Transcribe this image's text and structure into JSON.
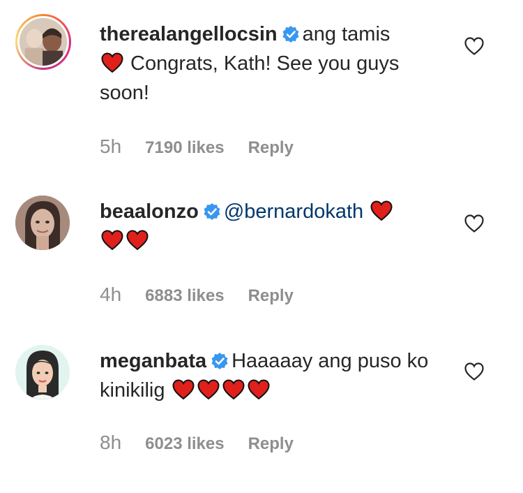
{
  "comments": [
    {
      "username": "therealangellocsin",
      "text_before": "ang tamis",
      "text_after": " Congrats, Kath! See you guys soon!",
      "age": "5h",
      "likes": "7190 likes",
      "reply": "Reply"
    },
    {
      "username": "beaalonzo",
      "mention": "@bernardokath",
      "age": "4h",
      "likes": "6883 likes",
      "reply": "Reply"
    },
    {
      "username": "meganbata",
      "text": "Haaaaay ang puso ko kinikilig",
      "age": "8h",
      "likes": "6023 likes",
      "reply": "Reply"
    }
  ],
  "icons": {
    "verified": "verified-badge-icon",
    "heart": "red-heart-emoji",
    "like": "heart-outline-icon"
  },
  "colors": {
    "verified_blue": "#3897f0",
    "heart_red": "#e0201b",
    "mention_blue": "#00376b",
    "meta_gray": "#8e8e8e"
  }
}
